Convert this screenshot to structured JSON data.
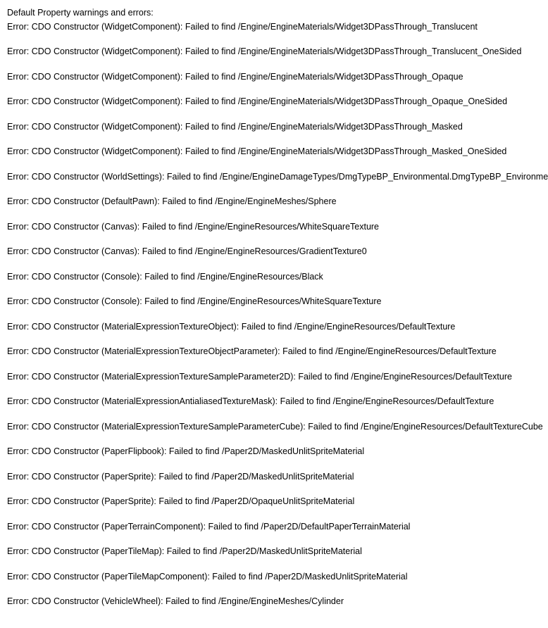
{
  "header": "Default Property warnings and errors:",
  "errors": [
    "Error: CDO Constructor (WidgetComponent): Failed to find /Engine/EngineMaterials/Widget3DPassThrough_Translucent",
    "Error: CDO Constructor (WidgetComponent): Failed to find /Engine/EngineMaterials/Widget3DPassThrough_Translucent_OneSided",
    "Error: CDO Constructor (WidgetComponent): Failed to find /Engine/EngineMaterials/Widget3DPassThrough_Opaque",
    "Error: CDO Constructor (WidgetComponent): Failed to find /Engine/EngineMaterials/Widget3DPassThrough_Opaque_OneSided",
    "Error: CDO Constructor (WidgetComponent): Failed to find /Engine/EngineMaterials/Widget3DPassThrough_Masked",
    "Error: CDO Constructor (WidgetComponent): Failed to find /Engine/EngineMaterials/Widget3DPassThrough_Masked_OneSided",
    "Error: CDO Constructor (WorldSettings): Failed to find /Engine/EngineDamageTypes/DmgTypeBP_Environmental.DmgTypeBP_Environmental_C",
    "Error: CDO Constructor (DefaultPawn): Failed to find /Engine/EngineMeshes/Sphere",
    "Error: CDO Constructor (Canvas): Failed to find /Engine/EngineResources/WhiteSquareTexture",
    "Error: CDO Constructor (Canvas): Failed to find /Engine/EngineResources/GradientTexture0",
    "Error: CDO Constructor (Console): Failed to find /Engine/EngineResources/Black",
    "Error: CDO Constructor (Console): Failed to find /Engine/EngineResources/WhiteSquareTexture",
    "Error: CDO Constructor (MaterialExpressionTextureObject): Failed to find /Engine/EngineResources/DefaultTexture",
    "Error: CDO Constructor (MaterialExpressionTextureObjectParameter): Failed to find /Engine/EngineResources/DefaultTexture",
    "Error: CDO Constructor (MaterialExpressionTextureSampleParameter2D): Failed to find /Engine/EngineResources/DefaultTexture",
    "Error: CDO Constructor (MaterialExpressionAntialiasedTextureMask): Failed to find /Engine/EngineResources/DefaultTexture",
    "Error: CDO Constructor (MaterialExpressionTextureSampleParameterCube): Failed to find /Engine/EngineResources/DefaultTextureCube",
    "Error: CDO Constructor (PaperFlipbook): Failed to find /Paper2D/MaskedUnlitSpriteMaterial",
    "Error: CDO Constructor (PaperSprite): Failed to find /Paper2D/MaskedUnlitSpriteMaterial",
    "Error: CDO Constructor (PaperSprite): Failed to find /Paper2D/OpaqueUnlitSpriteMaterial",
    "Error: CDO Constructor (PaperTerrainComponent): Failed to find /Paper2D/DefaultPaperTerrainMaterial",
    "Error: CDO Constructor (PaperTileMap): Failed to find /Paper2D/MaskedUnlitSpriteMaterial",
    "Error: CDO Constructor (PaperTileMapComponent): Failed to find /Paper2D/MaskedUnlitSpriteMaterial",
    "Error: CDO Constructor (VehicleWheel): Failed to find /Engine/EngineMeshes/Cylinder"
  ]
}
